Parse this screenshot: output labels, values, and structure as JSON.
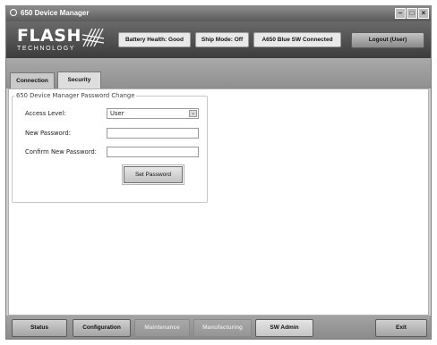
{
  "window": {
    "title": "650 Device Manager",
    "controls": [
      "minimize",
      "maximize",
      "close"
    ]
  },
  "header": {
    "logo_main": "FLASH",
    "logo_sub": "TECHNOLOGY",
    "status": {
      "battery": "Battery Health: Good",
      "ship_mode": "Ship Mode: Off",
      "connection": "A650 Blue SW Connected"
    },
    "logout_label": "Logout (User)"
  },
  "tabs": [
    {
      "label": "Connection",
      "active": false
    },
    {
      "label": "Security",
      "active": true
    }
  ],
  "password_panel": {
    "legend": "650 Device Manager Password Change",
    "access_level": {
      "label": "Access Level:",
      "value": "User"
    },
    "new_password": {
      "label": "New Password:",
      "value": ""
    },
    "confirm_password": {
      "label": "Confirm New Password:",
      "value": ""
    },
    "set_button": "Set Password"
  },
  "bottom_nav": [
    {
      "label": "Status",
      "state": "enabled"
    },
    {
      "label": "Configuration",
      "state": "enabled"
    },
    {
      "label": "Maintenance",
      "state": "disabled"
    },
    {
      "label": "Manufacturing",
      "state": "disabled"
    },
    {
      "label": "SW Admin",
      "state": "selected"
    },
    {
      "label": "Exit",
      "state": "enabled"
    }
  ]
}
